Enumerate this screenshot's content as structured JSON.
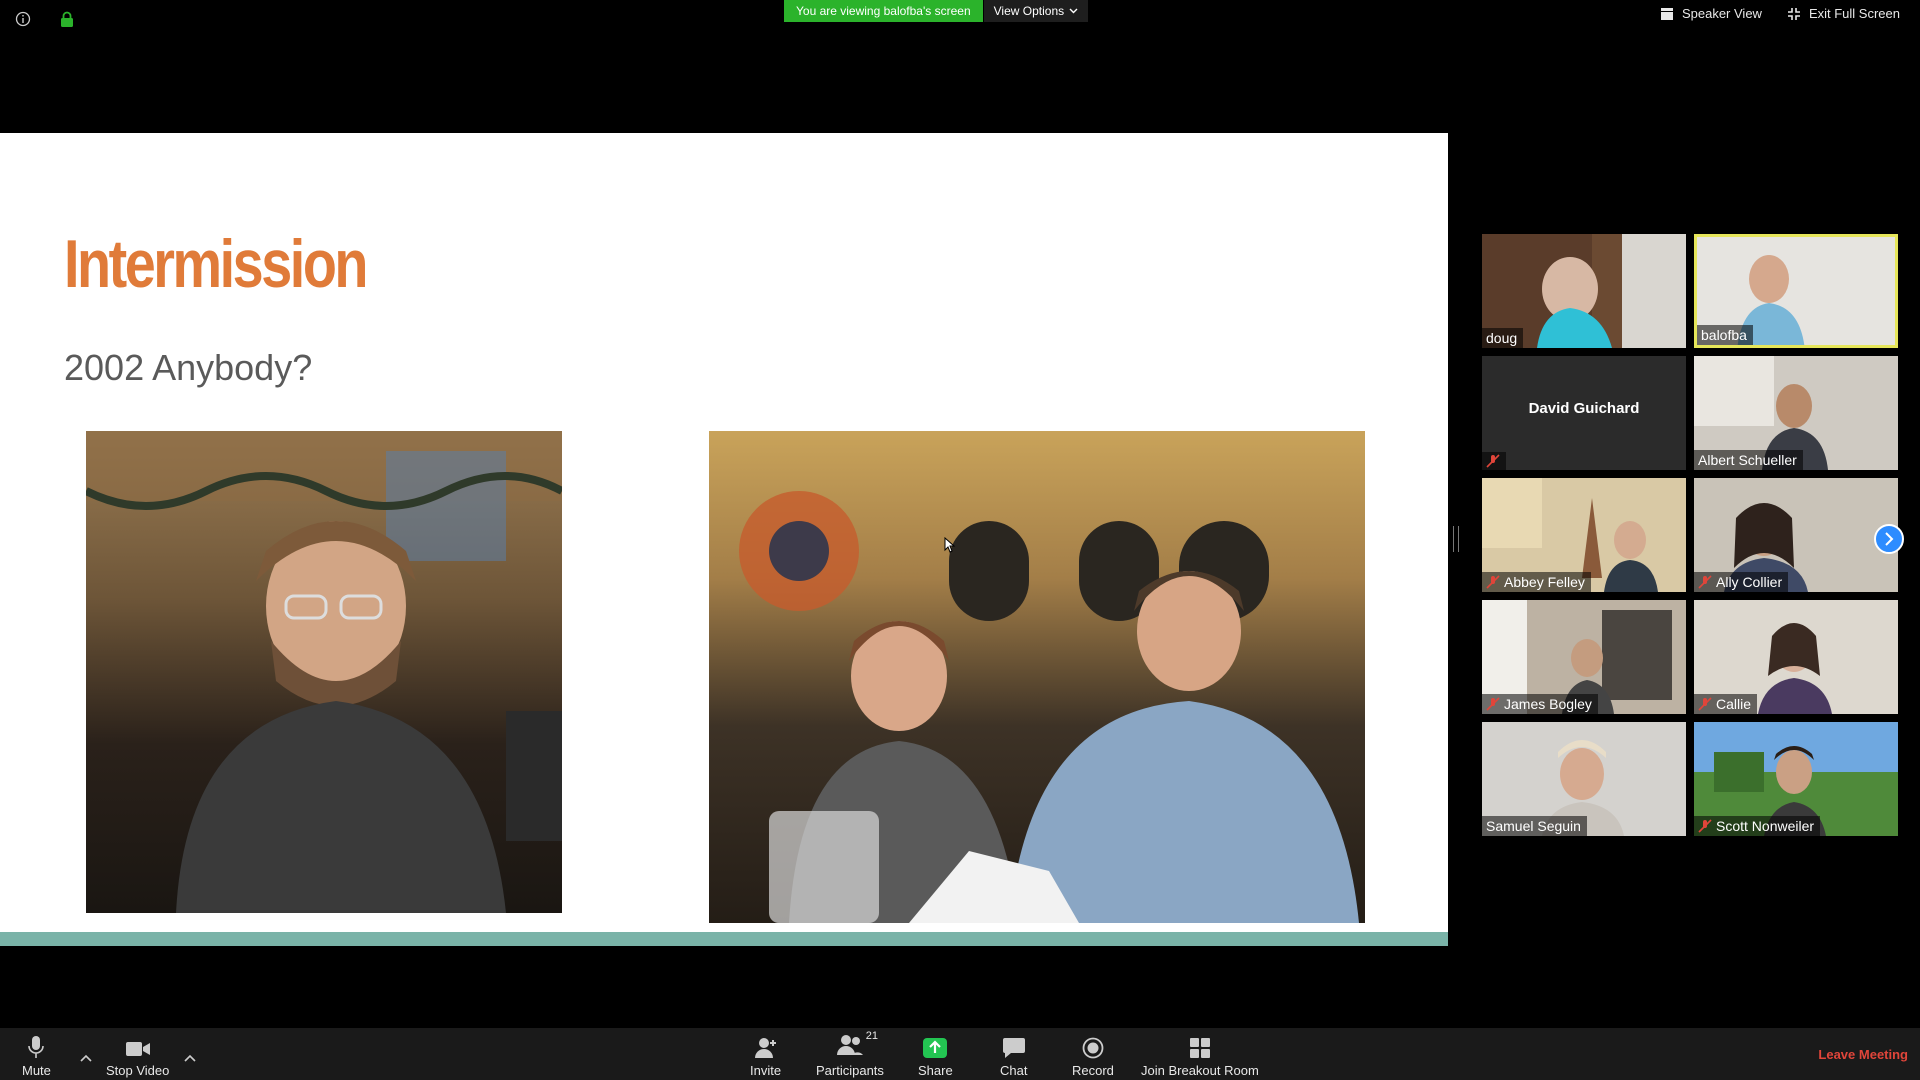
{
  "top": {
    "viewing_text": "You are viewing balofba's screen",
    "view_options_label": "View Options",
    "speaker_view_label": "Speaker View",
    "exit_fullscreen_label": "Exit Full Screen"
  },
  "slide": {
    "title": "Intermission",
    "subtitle": "2002 Anybody?"
  },
  "gallery": {
    "participants": [
      {
        "name": "doug",
        "muted": false,
        "video": true
      },
      {
        "name": "balofba",
        "muted": false,
        "video": true,
        "active_speaker": true
      },
      {
        "name": "David Guichard",
        "muted": true,
        "video": false
      },
      {
        "name": "Albert Schueller",
        "muted": false,
        "video": true
      },
      {
        "name": "Abbey Felley",
        "muted": true,
        "video": true
      },
      {
        "name": "Ally Collier",
        "muted": true,
        "video": true
      },
      {
        "name": "James Bogley",
        "muted": true,
        "video": true
      },
      {
        "name": "Callie",
        "muted": true,
        "video": true
      },
      {
        "name": "Samuel Seguin",
        "muted": false,
        "video": true
      },
      {
        "name": "Scott Nonweiler",
        "muted": true,
        "video": true
      }
    ]
  },
  "toolbar": {
    "mute_label": "Mute",
    "stop_video_label": "Stop Video",
    "invite_label": "Invite",
    "participants_label": "Participants",
    "participants_count": "21",
    "share_label": "Share",
    "chat_label": "Chat",
    "record_label": "Record",
    "breakout_label": "Join Breakout Room",
    "leave_label": "Leave Meeting"
  },
  "colors": {
    "slide_title": "#e07b39",
    "viewing_badge": "#2bb32b",
    "share_green": "#23c552",
    "leave_red": "#e0453a",
    "active_border": "#e6e65a",
    "footer_bar": "#7ab3a8"
  }
}
